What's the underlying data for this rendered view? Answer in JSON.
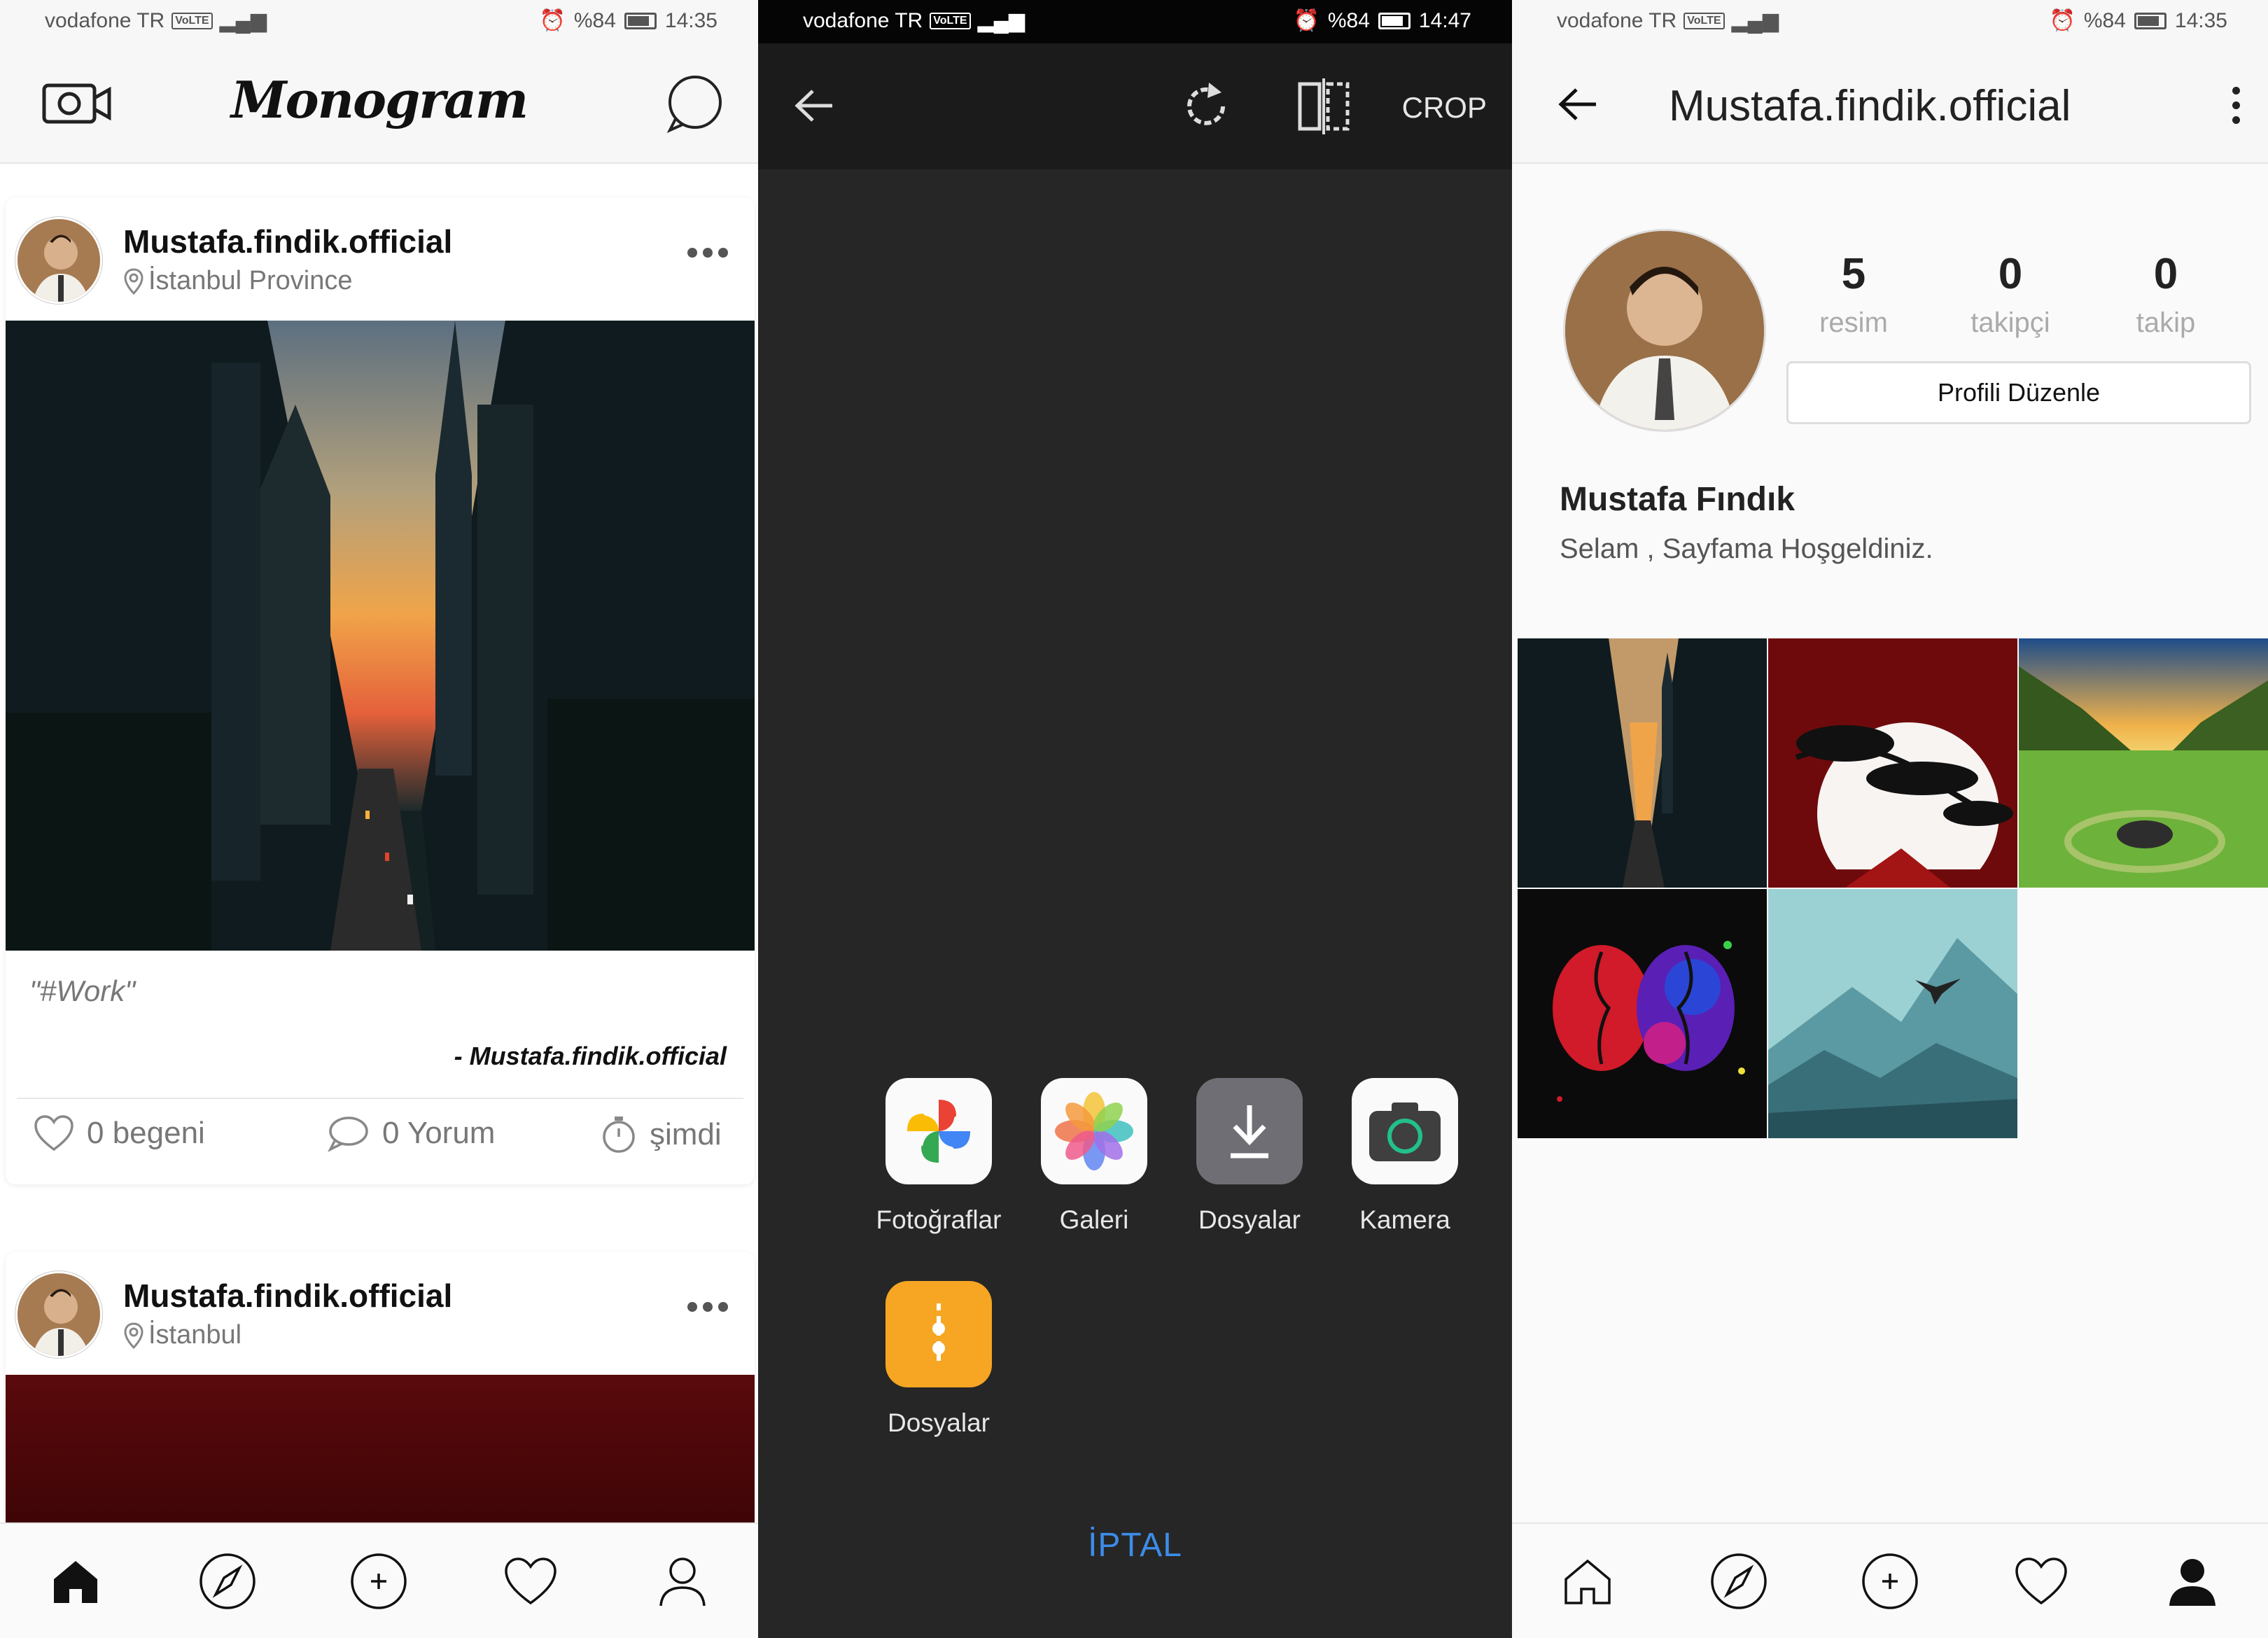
{
  "status_left": {
    "carrier": "vodafone TR",
    "volte": "VoLTE",
    "battery": "%84",
    "time": "14:35"
  },
  "status_mid": {
    "carrier": "vodafone TR",
    "volte": "VoLTE",
    "battery": "%84",
    "time": "14:47"
  },
  "status_right": {
    "carrier": "vodafone TR",
    "volte": "VoLTE",
    "battery": "%84",
    "time": "14:35"
  },
  "feed": {
    "logo": "Monogram",
    "posts": [
      {
        "username": "Mustafa.findik.official",
        "location": "İstanbul Province",
        "caption": "\"#Work\"",
        "author": "- Mustafa.findik.official",
        "likes": "0 begeni",
        "comments": "0 Yorum",
        "time": "şimdi"
      },
      {
        "username": "Mustafa.findik.official",
        "location": "İstanbul"
      }
    ]
  },
  "picker": {
    "crop_label": "CROP",
    "apps": [
      {
        "label": "Fotoğraflar",
        "icon": "google-photos-icon"
      },
      {
        "label": "Galeri",
        "icon": "gallery-icon"
      },
      {
        "label": "Dosyalar",
        "icon": "download-icon"
      },
      {
        "label": "Kamera",
        "icon": "camera-icon"
      },
      {
        "label": "Dosyalar",
        "icon": "files-folder-icon"
      }
    ],
    "cancel": "İPTAL"
  },
  "profile": {
    "title": "Mustafa.findik.official",
    "stats": [
      {
        "count": "5",
        "label": "resim"
      },
      {
        "count": "0",
        "label": "takipçi"
      },
      {
        "count": "0",
        "label": "takip"
      }
    ],
    "edit_button": "Profili Düzenle",
    "full_name": "Mustafa Fındık",
    "bio": "Selam , Sayfama Hoşgeldiniz.",
    "grid_count": 5
  },
  "colors": {
    "accent_blue": "#3d8ce8",
    "dark_bg": "#262626"
  }
}
